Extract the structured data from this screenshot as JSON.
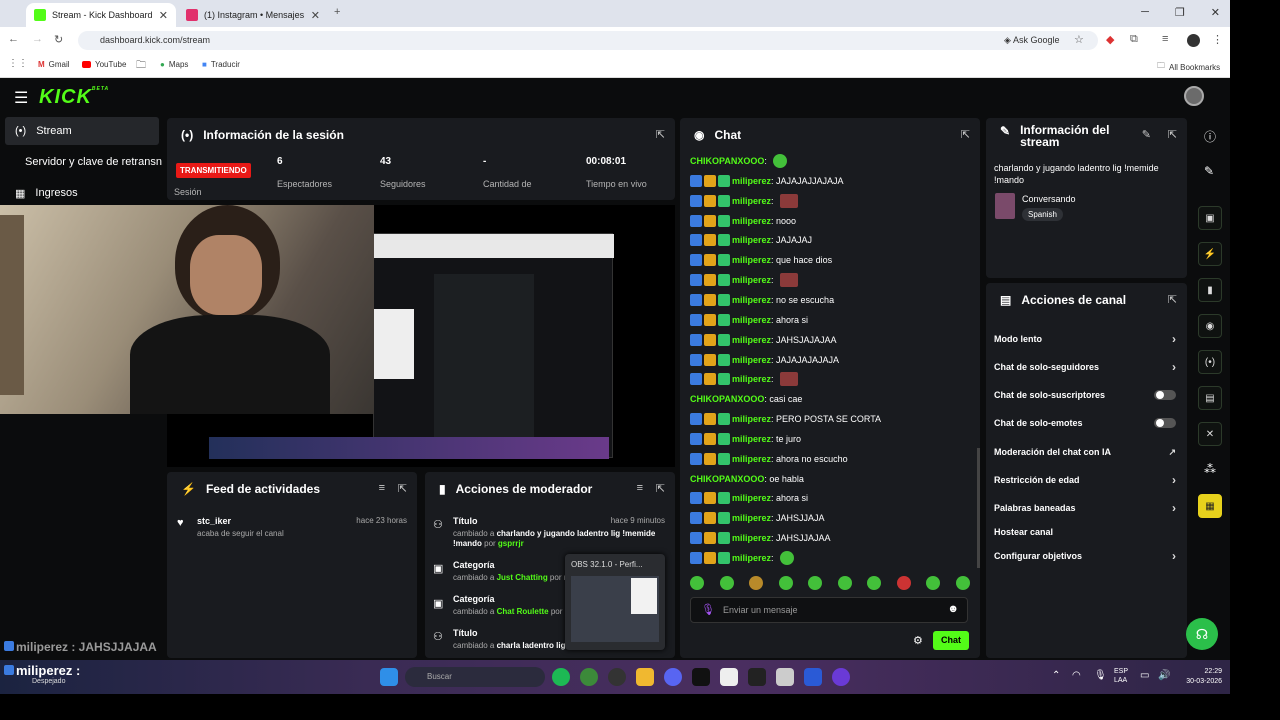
{
  "browser": {
    "tabs": [
      {
        "label": "Stream - Kick Dashboard",
        "active": true,
        "favicon_color": "#53fc18"
      },
      {
        "label": "(1) Instagram • Mensajes",
        "active": false,
        "favicon_color": "#e1306c"
      }
    ],
    "url": "dashboard.kick.com/stream",
    "ask_google": "Ask Google",
    "bookmarks": [
      "Gmail",
      "YouTube",
      "Maps",
      "Traducir"
    ],
    "all_bookmarks": "All Bookmarks"
  },
  "sidebar": {
    "items": [
      {
        "label": "Stream",
        "icon": "broadcast-icon",
        "active": true
      },
      {
        "label": "Servidor y clave de retransn",
        "icon": "",
        "active": false
      },
      {
        "label": "Ingresos",
        "icon": "chart-icon",
        "active": false
      }
    ]
  },
  "session": {
    "title": "Información de la sesión",
    "status_badge": "TRANSMITIENDO",
    "status_label": "Sesión",
    "stats": [
      {
        "value": "6",
        "label": "Espectadores"
      },
      {
        "value": "43",
        "label": "Seguidores"
      },
      {
        "value": "-",
        "label": "Cantidad de"
      },
      {
        "value": "00:08:01",
        "label": "Tiempo en vivo"
      }
    ]
  },
  "webcam_overlay": {
    "username": "miliperez :",
    "status": "Despejado",
    "chat_line": "miliperez : JAHSJJAJAA"
  },
  "activity": {
    "title": "Feed de actividades",
    "items": [
      {
        "user": "stc_iker",
        "text": "acaba de seguir el canal",
        "time": "hace 23 horas"
      }
    ]
  },
  "moderator": {
    "title": "Acciones de moderador",
    "items": [
      {
        "type": "Título",
        "time": "hace 9 minutos",
        "prefix": "cambiado a ",
        "value": "charlando y jugando ladentro lig !memide !mando",
        "by": " por ",
        "user": "gsprrjr"
      },
      {
        "type": "Categoría",
        "prefix": "cambiado a ",
        "value": "Just Chatting",
        "by": " por m"
      },
      {
        "type": "Categoría",
        "prefix": "cambiado a ",
        "value": "Chat Roulette",
        "by": " por m"
      },
      {
        "type": "Título",
        "prefix": "cambiado a ",
        "value": "charla ladentro lig",
        "by": ""
      }
    ],
    "obs_popup": "OBS 32.1.0 - Perfi..."
  },
  "chat": {
    "title": "Chat",
    "messages": [
      {
        "user": "CHIKOPANXOOO",
        "text": "",
        "emote": "green",
        "badges": 0
      },
      {
        "user": "miliperez",
        "text": "JAJAJAJJAJAJA",
        "badges": 3
      },
      {
        "user": "miliperez",
        "text": "",
        "emote": "red",
        "badges": 3
      },
      {
        "user": "miliperez",
        "text": "nooo",
        "badges": 3
      },
      {
        "user": "miliperez",
        "text": "JAJAJAJ",
        "badges": 3
      },
      {
        "user": "miliperez",
        "text": "que hace dios",
        "badges": 3
      },
      {
        "user": "miliperez",
        "text": "",
        "emote": "red",
        "badges": 3
      },
      {
        "user": "miliperez",
        "text": "no se escucha",
        "badges": 3
      },
      {
        "user": "miliperez",
        "text": "ahora si",
        "badges": 3
      },
      {
        "user": "miliperez",
        "text": "JAHSJAJAJAA",
        "badges": 3
      },
      {
        "user": "miliperez",
        "text": "JAJAJAJAJAJA",
        "badges": 3
      },
      {
        "user": "miliperez",
        "text": "",
        "emote": "red",
        "badges": 3
      },
      {
        "user": "CHIKOPANXOOO",
        "text": "casi cae",
        "badges": 0
      },
      {
        "user": "miliperez",
        "text": "PERO POSTA SE CORTA",
        "badges": 3
      },
      {
        "user": "miliperez",
        "text": "te juro",
        "badges": 3
      },
      {
        "user": "miliperez",
        "text": "ahora no escucho",
        "badges": 3
      },
      {
        "user": "CHIKOPANXOOO",
        "text": "oe habla",
        "badges": 0
      },
      {
        "user": "miliperez",
        "text": "ahora si",
        "badges": 3
      },
      {
        "user": "miliperez",
        "text": "JAHSJJAJA",
        "badges": 3
      },
      {
        "user": "miliperez",
        "text": "JAHSJJAJAA",
        "badges": 3
      },
      {
        "user": "miliperez",
        "text": "",
        "emote": "green",
        "badges": 3
      }
    ],
    "input_placeholder": "Enviar un mensaje",
    "send_label": "Chat"
  },
  "stream_info": {
    "title": "Información del stream",
    "stream_title": "charlando y jugando ladentro lig !memide !mando",
    "category": "Conversando",
    "language": "Spanish"
  },
  "channel_actions": {
    "title": "Acciones de canal",
    "items": [
      {
        "label": "Modo lento",
        "control": "chevron"
      },
      {
        "label": "Chat de solo-seguidores",
        "control": "chevron"
      },
      {
        "label": "Chat de solo-suscriptores",
        "control": "toggle"
      },
      {
        "label": "Chat de solo-emotes",
        "control": "toggle"
      },
      {
        "label": "Moderación del chat con IA",
        "control": "external"
      },
      {
        "label": "Restricción de edad",
        "control": "chevron"
      },
      {
        "label": "Palabras baneadas",
        "control": "chevron"
      },
      {
        "label": "Hostear canal",
        "control": "none"
      },
      {
        "label": "Configurar objetivos",
        "control": "chevron"
      }
    ]
  },
  "taskbar": {
    "search": "Buscar",
    "lang": "ESP",
    "lang2": "LAA",
    "time": "22:29",
    "date": "30-03-2026"
  },
  "colors": {
    "accent": "#53fc18",
    "live": "#e91916",
    "panel": "#191b1f"
  }
}
